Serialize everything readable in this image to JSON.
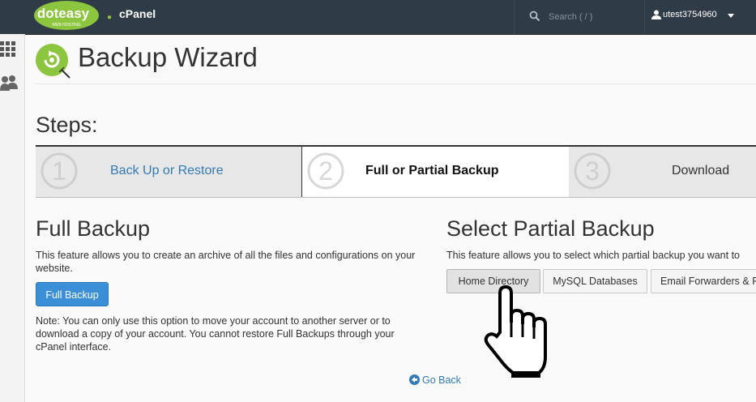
{
  "header": {
    "logo_text": "doteasy",
    "logo_subtext": "WEB HOSTING",
    "brand": "cPanel",
    "search_placeholder": "Search ( / )",
    "username": "utest3754960"
  },
  "page": {
    "title": "Backup Wizard"
  },
  "steps": {
    "title": "Steps:",
    "items": [
      {
        "number": "1",
        "label": "Back Up or Restore"
      },
      {
        "number": "2",
        "label": "Full or Partial Backup"
      },
      {
        "number": "3",
        "label": "Download"
      }
    ]
  },
  "full_backup": {
    "title": "Full Backup",
    "description": "This feature allows you to create an archive of all the files and configurations on your website.",
    "button_label": "Full Backup",
    "note": "Note: You can only use this option to move your account to another server or to download a copy of your account. You cannot restore Full Backups through your cPanel interface."
  },
  "partial_backup": {
    "title": "Select Partial Backup",
    "description": "This feature allows you to select which partial backup you want to",
    "buttons": [
      "Home Directory",
      "MySQL Databases",
      "Email Forwarders & Filters"
    ]
  },
  "go_back": "Go Back",
  "colors": {
    "topbar": "#2f3b46",
    "accent_green": "#8cc63f",
    "primary_blue": "#3a8fd6",
    "link_blue": "#337ab7"
  },
  "icons": [
    "search-icon",
    "user-icon",
    "caret-down-icon",
    "apps-grid-icon",
    "users-icon",
    "backup-wizard-icon",
    "back-arrow-icon",
    "hand-pointer-cursor-icon"
  ]
}
